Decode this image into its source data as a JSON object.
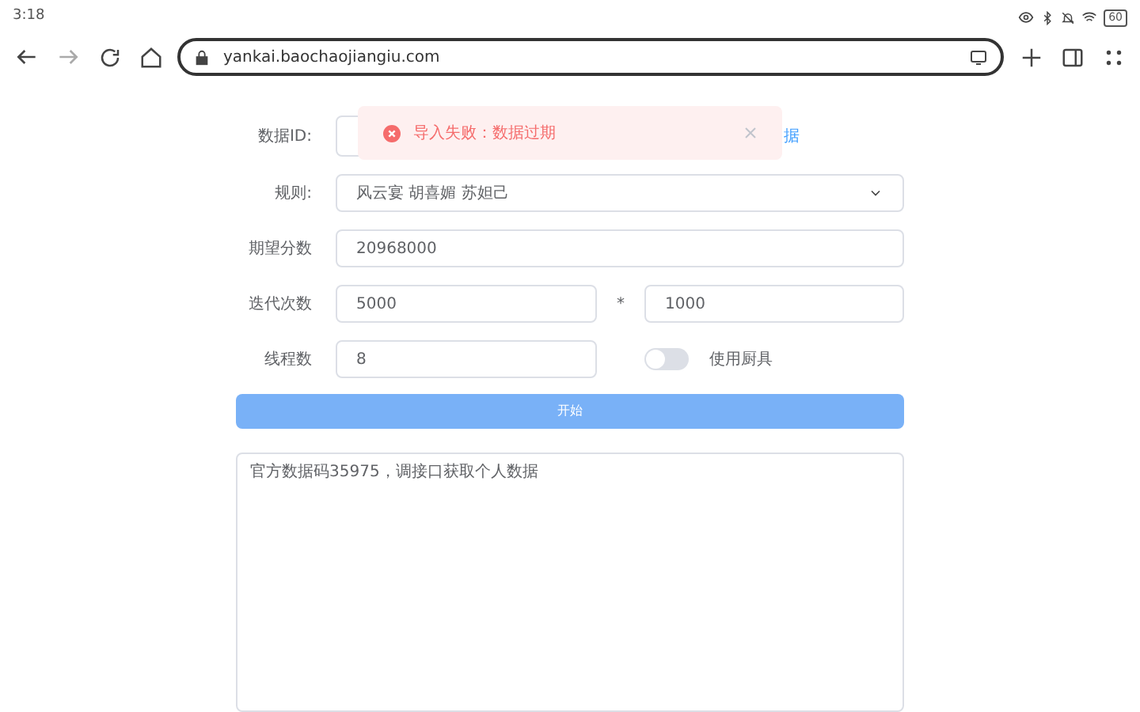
{
  "status_bar": {
    "time": "3:18",
    "battery": "60"
  },
  "browser": {
    "url": "yankai.baochaojiangiu.com"
  },
  "form": {
    "data_id": {
      "label": "数据ID:",
      "link": "据"
    },
    "rules": {
      "label": "规则:",
      "value": "风云宴 胡喜媚 苏妲己"
    },
    "target_score": {
      "label": "期望分数",
      "value": "20968000"
    },
    "iterations": {
      "label": "迭代次数",
      "value": "5000",
      "multiplier": "*",
      "value_2": "1000"
    },
    "threads": {
      "label": "线程数",
      "value": "8"
    },
    "use_utensils": {
      "label": "使用厨具",
      "on": false
    },
    "start_button": "开始",
    "output": "官方数据码35975，调接口获取个人数据"
  },
  "toast": {
    "kind": "error",
    "message": "导入失败：数据过期"
  }
}
